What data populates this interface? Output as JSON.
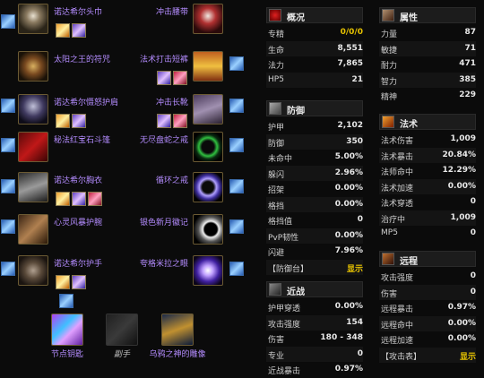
{
  "left_slots": [
    {
      "name": "诺达希尔头巾",
      "gems": 2
    },
    {
      "name": "太阳之王的符咒",
      "gems": 0
    },
    {
      "name": "诺达希尔慑怒护肩",
      "gems": 2
    },
    {
      "name": "秘法红宝石斗篷",
      "gems": 0
    },
    {
      "name": "诺达希尔胸衣",
      "gems": 3
    },
    {
      "name": "心灵风暴护腕",
      "gems": 0
    },
    {
      "name": "诺达希尔护手",
      "gems": 2
    }
  ],
  "right_slots": [
    {
      "name": "冲击腰带",
      "gems": 0
    },
    {
      "name": "法术打击短裤",
      "gems": 2
    },
    {
      "name": "冲击长靴",
      "gems": 2
    },
    {
      "name": "无尽盘蛇之戒",
      "gems": 0
    },
    {
      "name": "循环之戒",
      "gems": 0
    },
    {
      "name": "银色新月徽记",
      "gems": 0
    },
    {
      "name": "夸格米拉之眼",
      "gems": 0
    }
  ],
  "weapons": [
    {
      "name": "节点钥匙"
    },
    {
      "name": "副手"
    },
    {
      "name": "乌鸦之神的雕像"
    }
  ],
  "panels": {
    "overview": {
      "title": "概况",
      "rows": [
        {
          "k": "专精",
          "v": "0/0/0",
          "gold": true
        },
        {
          "k": "生命",
          "v": "8,551"
        },
        {
          "k": "法力",
          "v": "7,865"
        },
        {
          "k": "HP5",
          "v": "21"
        }
      ]
    },
    "defense": {
      "title": "防御",
      "rows": [
        {
          "k": "护甲",
          "v": "2,102"
        },
        {
          "k": "防御",
          "v": "350"
        },
        {
          "k": "未命中",
          "v": "5.00%"
        },
        {
          "k": "躲闪",
          "v": "2.96%"
        },
        {
          "k": "招架",
          "v": "0.00%"
        },
        {
          "k": "格挡",
          "v": "0.00%"
        },
        {
          "k": "格挡值",
          "v": "0"
        },
        {
          "k": "PvP韧性",
          "v": "0.00%"
        },
        {
          "k": "闪避",
          "v": "7.96%"
        },
        {
          "k": "【防御台】",
          "v": "显示",
          "link": true
        }
      ]
    },
    "melee": {
      "title": "近战",
      "rows": [
        {
          "k": "护甲穿透",
          "v": "0.00%"
        },
        {
          "k": "攻击强度",
          "v": "154"
        },
        {
          "k": "伤害",
          "v": "180 - 348"
        },
        {
          "k": "专业",
          "v": "0"
        },
        {
          "k": "近战暴击",
          "v": "0.97%"
        }
      ]
    },
    "attributes": {
      "title": "属性",
      "rows": [
        {
          "k": "力量",
          "v": "87"
        },
        {
          "k": "敏捷",
          "v": "71"
        },
        {
          "k": "耐力",
          "v": "471"
        },
        {
          "k": "智力",
          "v": "385"
        },
        {
          "k": "精神",
          "v": "229"
        }
      ]
    },
    "spell": {
      "title": "法术",
      "rows": [
        {
          "k": "法术伤害",
          "v": "1,009"
        },
        {
          "k": "法术暴击",
          "v": "20.84%"
        },
        {
          "k": "法师命中",
          "v": "12.29%"
        },
        {
          "k": "法术加速",
          "v": "0.00%"
        },
        {
          "k": "法术穿透",
          "v": "0"
        },
        {
          "k": "治疗中",
          "v": "1,009"
        },
        {
          "k": "MP5",
          "v": "0"
        }
      ]
    },
    "ranged": {
      "title": "远程",
      "rows": [
        {
          "k": "攻击强度",
          "v": "0"
        },
        {
          "k": "伤害",
          "v": "0"
        },
        {
          "k": "远程暴击",
          "v": "0.97%"
        },
        {
          "k": "远程命中",
          "v": "0.00%"
        },
        {
          "k": "远程加速",
          "v": "0.00%"
        },
        {
          "k": "【攻击表】",
          "v": "显示",
          "link": true
        }
      ]
    }
  },
  "colors": {
    "item_name": "#b48cff",
    "gold": "#e6c200",
    "panel_head": "#1c1c1c"
  }
}
